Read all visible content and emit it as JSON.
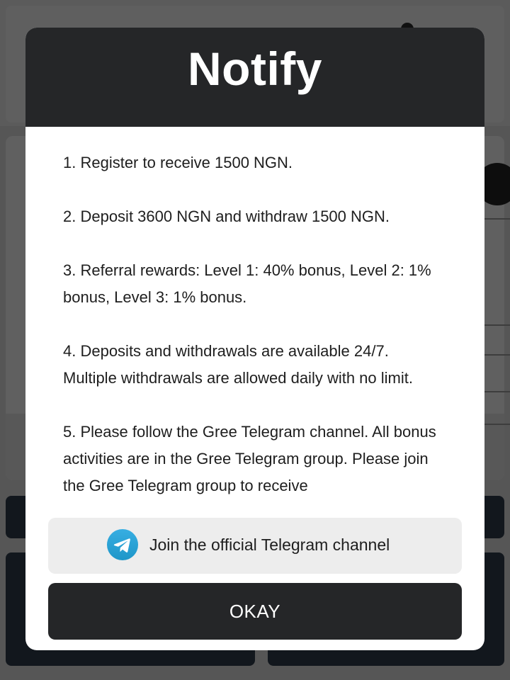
{
  "modal": {
    "title": "Notify",
    "items": [
      "1. Register to receive 1500 NGN.",
      "2. Deposit 3600 NGN and withdraw 1500 NGN.",
      "3. Referral rewards: Level 1: 40% bonus, Level 2: 1% bonus, Level 3: 1% bonus.",
      "4. Deposits and withdrawals are available 24/7. Multiple withdrawals are allowed daily with no limit.",
      "5. Please follow the Gree Telegram channel. All bonus activities are in the Gree Telegram group. Please join the Gree Telegram group to receive"
    ],
    "telegram_button": {
      "label": "Join the official Telegram channel",
      "icon": "telegram-icon"
    },
    "okay_button": {
      "label": "OKAY"
    }
  },
  "colors": {
    "header_bg": "#252628",
    "telegram_blue": "#2aa3e0",
    "button_dark": "#252628",
    "button_light": "#ededed"
  }
}
